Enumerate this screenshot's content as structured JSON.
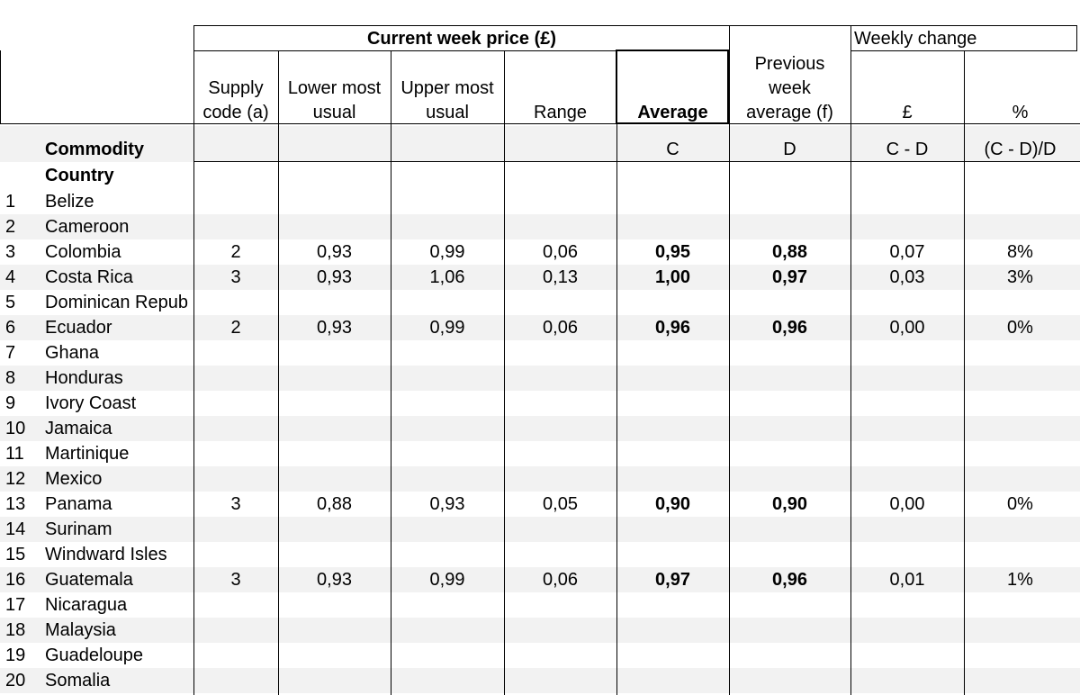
{
  "header": {
    "current_week_price": "Current week price (£)",
    "weekly_change": "Weekly change",
    "columns": {
      "supply_code": [
        "Supply",
        "code (a)"
      ],
      "lower": [
        "Lower most",
        "usual"
      ],
      "upper": [
        "Upper most",
        "usual"
      ],
      "range": [
        "Range"
      ],
      "average": [
        "Average"
      ],
      "previous": [
        "Previous",
        "week",
        "average (f)"
      ],
      "pound": [
        "£"
      ],
      "percent": [
        "%"
      ]
    },
    "labels": {
      "commodity": "Commodity",
      "country": "Country",
      "avg_code": "C",
      "prev_code": "D",
      "diff_code": "C - D",
      "pct_code": "(C - D)/D"
    }
  },
  "rows": [
    {
      "n": "1",
      "country": "Belize",
      "supply": "",
      "lower": "",
      "upper": "",
      "range": "",
      "average": "",
      "previous": "",
      "change": "",
      "pct": ""
    },
    {
      "n": "2",
      "country": "Cameroon",
      "supply": "",
      "lower": "",
      "upper": "",
      "range": "",
      "average": "",
      "previous": "",
      "change": "",
      "pct": ""
    },
    {
      "n": "3",
      "country": "Colombia",
      "supply": "2",
      "lower": "0,93",
      "upper": "0,99",
      "range": "0,06",
      "average": "0,95",
      "previous": "0,88",
      "change": "0,07",
      "pct": "8%"
    },
    {
      "n": "4",
      "country": "Costa Rica",
      "supply": "3",
      "lower": "0,93",
      "upper": "1,06",
      "range": "0,13",
      "average": "1,00",
      "previous": "0,97",
      "change": "0,03",
      "pct": "3%"
    },
    {
      "n": "5",
      "country": "Dominican Repub",
      "supply": "",
      "lower": "",
      "upper": "",
      "range": "",
      "average": "",
      "previous": "",
      "change": "",
      "pct": ""
    },
    {
      "n": "6",
      "country": "Ecuador",
      "supply": "2",
      "lower": "0,93",
      "upper": "0,99",
      "range": "0,06",
      "average": "0,96",
      "previous": "0,96",
      "change": "0,00",
      "pct": "0%"
    },
    {
      "n": "7",
      "country": "Ghana",
      "supply": "",
      "lower": "",
      "upper": "",
      "range": "",
      "average": "",
      "previous": "",
      "change": "",
      "pct": ""
    },
    {
      "n": "8",
      "country": "Honduras",
      "supply": "",
      "lower": "",
      "upper": "",
      "range": "",
      "average": "",
      "previous": "",
      "change": "",
      "pct": ""
    },
    {
      "n": "9",
      "country": "Ivory Coast",
      "supply": "",
      "lower": "",
      "upper": "",
      "range": "",
      "average": "",
      "previous": "",
      "change": "",
      "pct": ""
    },
    {
      "n": "10",
      "country": "Jamaica",
      "supply": "",
      "lower": "",
      "upper": "",
      "range": "",
      "average": "",
      "previous": "",
      "change": "",
      "pct": ""
    },
    {
      "n": "11",
      "country": "Martinique",
      "supply": "",
      "lower": "",
      "upper": "",
      "range": "",
      "average": "",
      "previous": "",
      "change": "",
      "pct": ""
    },
    {
      "n": "12",
      "country": "Mexico",
      "supply": "",
      "lower": "",
      "upper": "",
      "range": "",
      "average": "",
      "previous": "",
      "change": "",
      "pct": ""
    },
    {
      "n": "13",
      "country": "Panama",
      "supply": "3",
      "lower": "0,88",
      "upper": "0,93",
      "range": "0,05",
      "average": "0,90",
      "previous": "0,90",
      "change": "0,00",
      "pct": "0%"
    },
    {
      "n": "14",
      "country": "Surinam",
      "supply": "",
      "lower": "",
      "upper": "",
      "range": "",
      "average": "",
      "previous": "",
      "change": "",
      "pct": ""
    },
    {
      "n": "15",
      "country": "Windward Isles",
      "supply": "",
      "lower": "",
      "upper": "",
      "range": "",
      "average": "",
      "previous": "",
      "change": "",
      "pct": ""
    },
    {
      "n": "16",
      "country": "Guatemala",
      "supply": "3",
      "lower": "0,93",
      "upper": "0,99",
      "range": "0,06",
      "average": "0,97",
      "previous": "0,96",
      "change": "0,01",
      "pct": "1%"
    },
    {
      "n": "17",
      "country": "Nicaragua",
      "supply": "",
      "lower": "",
      "upper": "",
      "range": "",
      "average": "",
      "previous": "",
      "change": "",
      "pct": ""
    },
    {
      "n": "18",
      "country": "Malaysia",
      "supply": "",
      "lower": "",
      "upper": "",
      "range": "",
      "average": "",
      "previous": "",
      "change": "",
      "pct": ""
    },
    {
      "n": "19",
      "country": "Guadeloupe",
      "supply": "",
      "lower": "",
      "upper": "",
      "range": "",
      "average": "",
      "previous": "",
      "change": "",
      "pct": ""
    },
    {
      "n": "20",
      "country": "Somalia",
      "supply": "",
      "lower": "",
      "upper": "",
      "range": "",
      "average": "",
      "previous": "",
      "change": "",
      "pct": ""
    }
  ],
  "colors": {
    "band": "#f2f2f2",
    "grid": "#000000",
    "background": "#ffffff"
  }
}
